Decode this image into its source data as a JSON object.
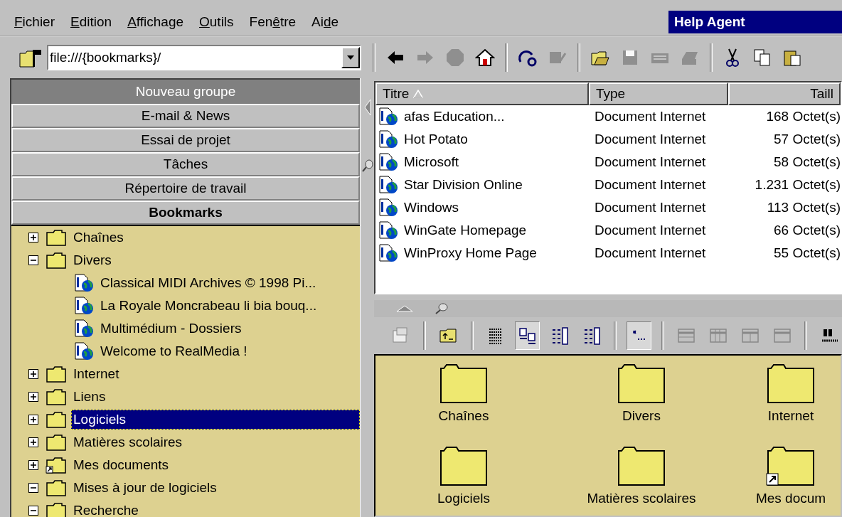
{
  "menu": [
    {
      "key": "F",
      "post": "ichier"
    },
    {
      "key": "E",
      "post": "dition"
    },
    {
      "key": "A",
      "post": "ffichage"
    },
    {
      "key": "O",
      "post": "utils"
    },
    {
      "pre": "Fen",
      "key": "ê",
      "post": "tre"
    },
    {
      "pre": "Ai",
      "key": "d",
      "post": "e"
    }
  ],
  "help_agent": {
    "title": "Help Agent"
  },
  "address": {
    "value": "file:///{bookmarks}/"
  },
  "toolbar_groups": [
    [
      {
        "kind": "back",
        "disabled": false
      },
      {
        "kind": "forward",
        "disabled": true
      },
      {
        "kind": "stop",
        "disabled": true
      },
      {
        "kind": "home",
        "disabled": false
      }
    ],
    [
      {
        "kind": "reload",
        "disabled": false
      },
      {
        "kind": "edit",
        "disabled": true
      }
    ],
    [
      {
        "kind": "open",
        "disabled": false
      },
      {
        "kind": "save",
        "disabled": true
      },
      {
        "kind": "mail",
        "disabled": true
      },
      {
        "kind": "print",
        "disabled": true
      }
    ],
    [
      {
        "kind": "cut",
        "disabled": false
      },
      {
        "kind": "copy",
        "disabled": false
      },
      {
        "kind": "paste",
        "disabled": false
      }
    ]
  ],
  "groups": [
    {
      "label": "Nouveau groupe",
      "kind": "new",
      "selected": false
    },
    {
      "label": "E-mail & News",
      "kind": "group",
      "selected": false
    },
    {
      "label": "Essai de projet",
      "kind": "group",
      "selected": false
    },
    {
      "label": "Tâches",
      "kind": "group",
      "selected": false
    },
    {
      "label": "Répertoire de travail",
      "kind": "group",
      "selected": false
    },
    {
      "label": "Bookmarks",
      "kind": "group",
      "selected": true
    }
  ],
  "tree": [
    {
      "label": "Chaînes",
      "kind": "folder",
      "expanded": false,
      "selected": false,
      "shortcut": false
    },
    {
      "label": "Divers",
      "kind": "folder",
      "expanded": true,
      "selected": false,
      "shortcut": false,
      "children": [
        {
          "label": "Classical MIDI Archives © 1998 Pi...",
          "kind": "link",
          "selected": false
        },
        {
          "label": "La Royale Moncrabeau li bia bouq...",
          "kind": "link",
          "selected": false
        },
        {
          "label": "Multimédium - Dossiers",
          "kind": "link",
          "selected": false
        },
        {
          "label": "Welcome to RealMedia !",
          "kind": "link",
          "selected": false
        }
      ]
    },
    {
      "label": "Internet",
      "kind": "folder",
      "expanded": false,
      "selected": false,
      "shortcut": false
    },
    {
      "label": "Liens",
      "kind": "folder",
      "expanded": false,
      "selected": false,
      "shortcut": false
    },
    {
      "label": "Logiciels",
      "kind": "folder",
      "expanded": false,
      "selected": true,
      "shortcut": false
    },
    {
      "label": "Matières scolaires",
      "kind": "folder",
      "expanded": false,
      "selected": false,
      "shortcut": false
    },
    {
      "label": "Mes documents",
      "kind": "folder",
      "expanded": false,
      "selected": false,
      "shortcut": true
    },
    {
      "label": "Mises à jour de logiciels",
      "kind": "folder",
      "expanded": true,
      "selected": false,
      "shortcut": false
    },
    {
      "label": "Recherche",
      "kind": "folder",
      "expanded": true,
      "selected": false,
      "shortcut": false
    }
  ],
  "table": {
    "columns": [
      {
        "label": "Titre",
        "sorted": true
      },
      {
        "label": "Type",
        "sorted": false
      },
      {
        "label": "Taill",
        "sorted": false
      }
    ],
    "rows": [
      {
        "title": "afas  Education...",
        "type": "Document Internet",
        "size": "168 Octet(s)"
      },
      {
        "title": "Hot Potato",
        "type": "Document Internet",
        "size": "57 Octet(s)"
      },
      {
        "title": "Microsoft",
        "type": "Document Internet",
        "size": "58 Octet(s)"
      },
      {
        "title": "Star Division Online",
        "type": "Document Internet",
        "size": "1.231 Octet(s)"
      },
      {
        "title": "Windows",
        "type": "Document Internet",
        "size": "113 Octet(s)"
      },
      {
        "title": "WinGate Homepage",
        "type": "Document Internet",
        "size": "66 Octet(s)"
      },
      {
        "title": "WinProxy Home Page",
        "type": "Document Internet",
        "size": "55 Octet(s)"
      }
    ]
  },
  "view_toolbar_groups": [
    [
      {
        "kind": "properties",
        "pressed": false
      }
    ],
    [
      {
        "kind": "folder-up",
        "pressed": false
      }
    ],
    [
      {
        "kind": "details",
        "pressed": false
      },
      {
        "kind": "large-icons",
        "pressed": true
      },
      {
        "kind": "small-icons",
        "pressed": false
      },
      {
        "kind": "list",
        "pressed": false
      }
    ],
    [
      {
        "kind": "filter",
        "pressed": true
      }
    ],
    [
      {
        "kind": "layout-rows",
        "pressed": false
      },
      {
        "kind": "layout-columns",
        "pressed": false
      },
      {
        "kind": "layout-split",
        "pressed": false
      },
      {
        "kind": "layout-top",
        "pressed": false
      }
    ],
    [
      {
        "kind": "find",
        "pressed": false
      }
    ]
  ],
  "icons": [
    {
      "label": "Chaînes",
      "shortcut": false
    },
    {
      "label": "Divers",
      "shortcut": false
    },
    {
      "label": "Internet",
      "shortcut": false
    },
    {
      "label": "Logiciels",
      "shortcut": false
    },
    {
      "label": "Matières scolaires",
      "shortcut": false
    },
    {
      "label": "Mes docum",
      "shortcut": true
    }
  ]
}
